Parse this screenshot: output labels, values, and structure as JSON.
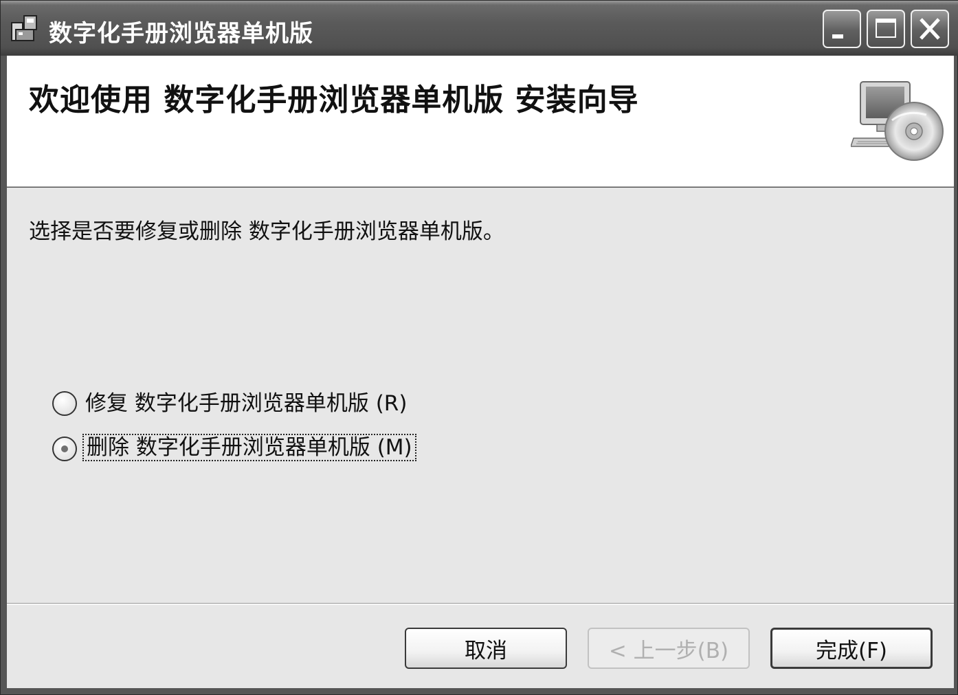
{
  "window": {
    "title": "数字化手册浏览器单机版"
  },
  "banner": {
    "title": "欢迎使用 数字化手册浏览器单机版 安装向导",
    "art_icon": "computer-cd-icon"
  },
  "content": {
    "prompt": "选择是否要修复或删除 数字化手册浏览器单机版。",
    "options": [
      {
        "label": "修复 数字化手册浏览器单机版 (R)",
        "selected": false
      },
      {
        "label": "删除 数字化手册浏览器单机版 (M)",
        "selected": true
      }
    ]
  },
  "buttons": {
    "cancel": "取消",
    "back": "< 上一步(B)",
    "finish": "完成(F)"
  }
}
